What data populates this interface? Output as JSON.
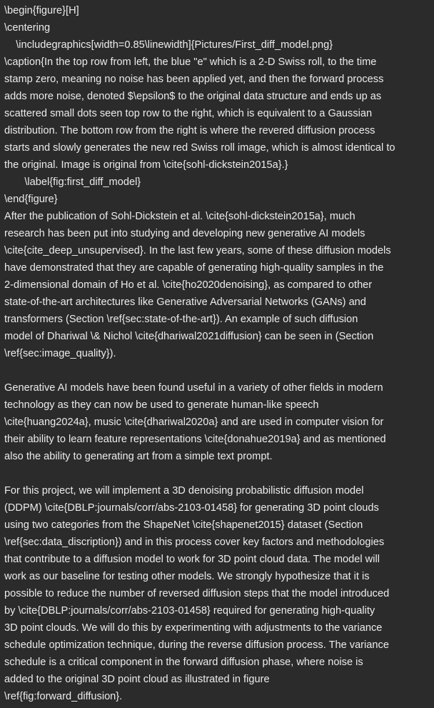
{
  "editor": {
    "lines": [
      "\\begin{figure}[H]",
      "\\centering",
      "    \\includegraphics[width=0.85\\linewidth]{Pictures/First_diff_model.png}",
      "\\caption{In the top row from left, the blue \"e\" which is a 2-D Swiss roll, to the time",
      "stamp zero, meaning no noise has been applied yet, and then the forward process",
      "adds more noise, denoted $\\epsilon$ to the original data structure and ends up as",
      "scattered small dots seen top row to the right, which is equivalent to a Gaussian",
      "distribution. The bottom row from the right is where the revered diffusion process",
      "starts and slowly generates the new red Swiss roll image, which is almost identical to",
      "the original. Image is original from \\cite{sohl-dickstein2015a}.}",
      "       \\label{fig:first_diff_model}",
      "\\end{figure}",
      "After the publication of Sohl-Dickstein et al. \\cite{sohl-dickstein2015a}, much",
      "research has been put into studying and developing new generative AI models",
      "\\cite{cite_deep_unsupervised}. In the last few years, some of these diffusion models",
      "have demonstrated that they are capable of generating high-quality samples in the",
      "2-dimensional domain of Ho et al. \\cite{ho2020denoising}, as compared to other",
      "state-of-the-art architectures like Generative Adversarial Networks (GANs) and",
      "transformers (Section \\ref{sec:state-of-the-art}). An example of such diffusion",
      "model of Dhariwal \\& Nichol \\cite{dhariwal2021diffusion} can be seen in (Section",
      "\\ref{sec:image_quality}).",
      "",
      "Generative AI models have been found useful in a variety of other fields in modern",
      "technology as they can now be used to generate human-like speech",
      "\\cite{huang2024a}, music \\cite{dhariwal2020a} and are used in computer vision for",
      "their ability to learn feature representations \\cite{donahue2019a} and as mentioned",
      "also the ability to generating art from a simple text prompt.",
      "",
      "For this project, we will implement a 3D denoising probabilistic diffusion model",
      "(DDPM) \\cite{DBLP:journals/corr/abs-2103-01458} for generating 3D point clouds",
      "using two categories from the ShapeNet \\cite{shapenet2015} dataset (Section",
      "\\ref{sec:data_discription}) and in this process cover key factors and methodologies",
      "that contribute to a diffusion model to work for 3D point cloud data. The model will",
      "work as our baseline for testing other models. We strongly hypothesize that it is",
      "possible to reduce the number of reversed diffusion steps that the model introduced",
      "by \\cite{DBLP:journals/corr/abs-2103-01458} required for generating high-quality",
      "3D point clouds. We will do this by experimenting with adjustments to the variance",
      "schedule optimization technique, during the reverse diffusion process. The variance",
      "schedule is a critical component in the forward diffusion phase, where noise is",
      "added to the original 3D point cloud as illustrated in figure",
      "\\ref{fig:forward_diffusion}."
    ]
  }
}
